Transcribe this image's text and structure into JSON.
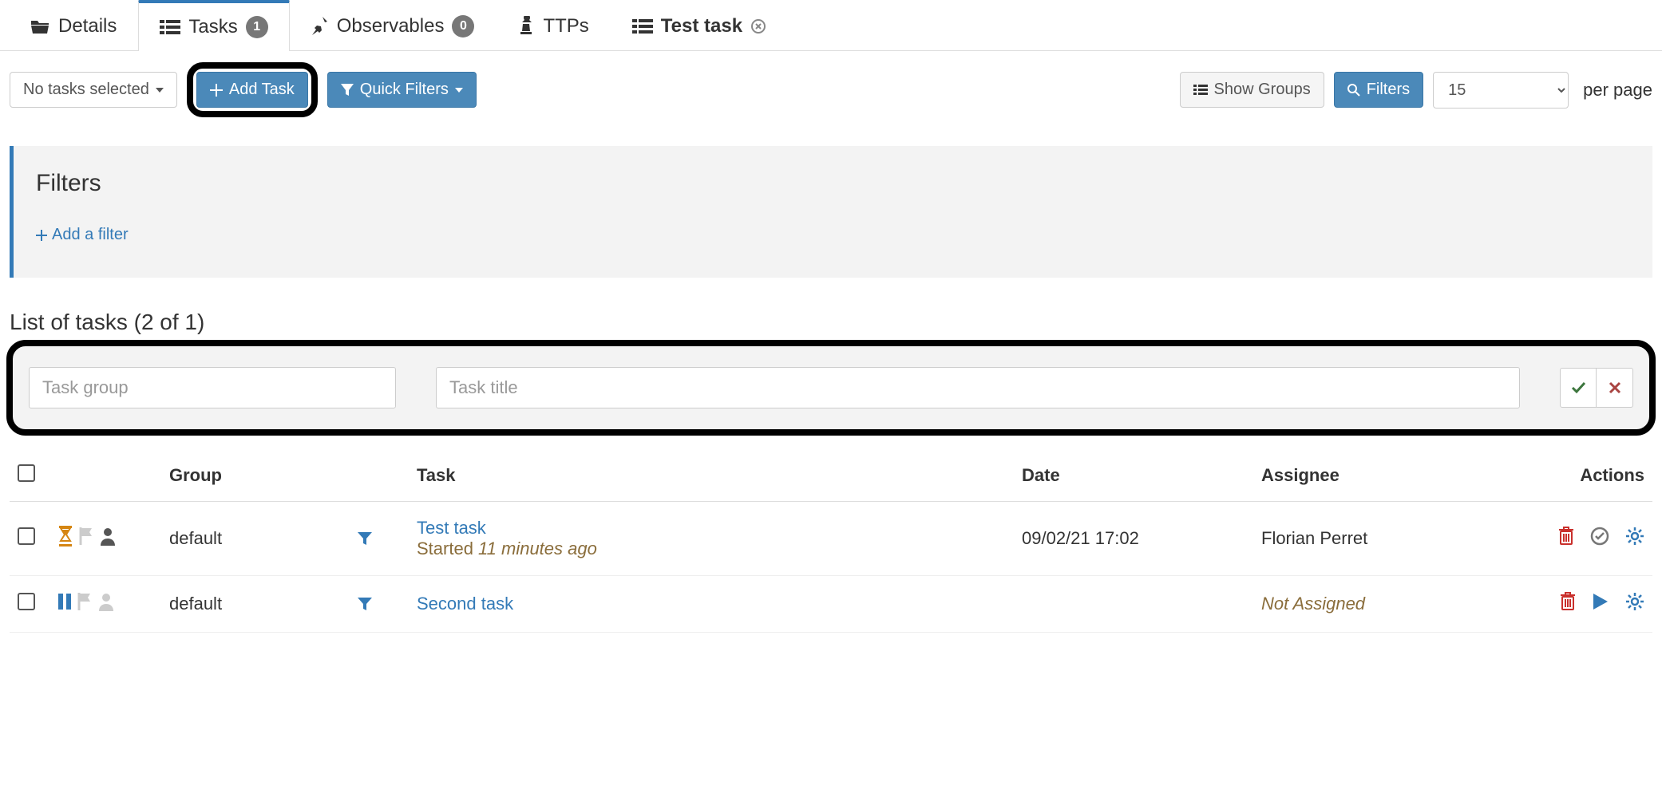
{
  "tabs": {
    "details": "Details",
    "tasks": "Tasks",
    "tasks_count": "1",
    "observables": "Observables",
    "observables_count": "0",
    "ttps": "TTPs",
    "test_task": "Test task"
  },
  "toolbar": {
    "no_tasks_selected": "No tasks selected",
    "add_task": "Add Task",
    "quick_filters": "Quick Filters",
    "show_groups": "Show Groups",
    "filters": "Filters",
    "per_page_value": "15",
    "per_page_label": "per page"
  },
  "filters_panel": {
    "title": "Filters",
    "add_filter": "Add a filter"
  },
  "list": {
    "heading": "List of tasks  (2 of 1)",
    "new_task": {
      "group_placeholder": "Task group",
      "title_placeholder": "Task title"
    },
    "columns": {
      "group": "Group",
      "task": "Task",
      "date": "Date",
      "assignee": "Assignee",
      "actions": "Actions"
    },
    "rows": [
      {
        "status": "inprogress",
        "group": "default",
        "title": "Test task",
        "sub_prefix": "Started ",
        "sub_time": "11 minutes ago",
        "date": "09/02/21 17:02",
        "assignee": "Florian Perret",
        "assigned": true
      },
      {
        "status": "paused",
        "group": "default",
        "title": "Second task",
        "sub_prefix": "",
        "sub_time": "",
        "date": "",
        "assignee": "Not Assigned",
        "assigned": false
      }
    ]
  }
}
